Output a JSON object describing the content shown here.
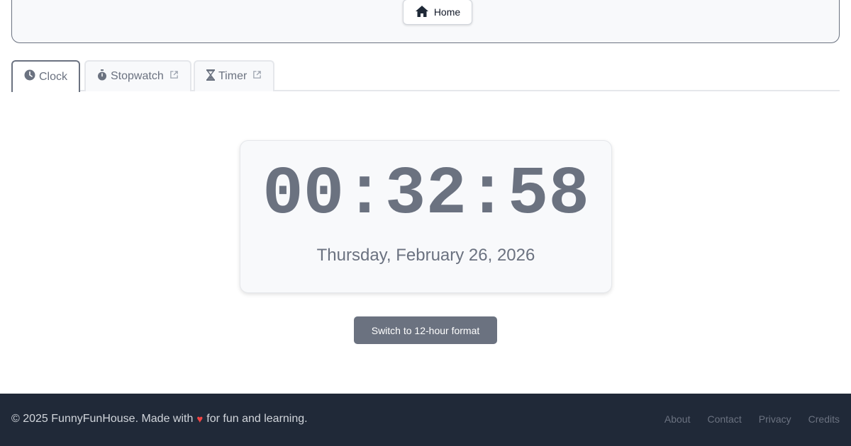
{
  "nav": {
    "home_label": "Home",
    "home_icon": "home-icon"
  },
  "tabs": [
    {
      "label": "Clock",
      "icon": "clock-icon",
      "active": true,
      "external": false
    },
    {
      "label": "Stopwatch",
      "icon": "stopwatch-icon",
      "active": false,
      "external": true
    },
    {
      "label": "Timer",
      "icon": "hourglass-icon",
      "active": false,
      "external": true
    }
  ],
  "clock": {
    "time": "00:32:58",
    "date": "Thursday, February 26, 2026"
  },
  "format_toggle": {
    "label": "Switch to 12-hour format"
  },
  "footer": {
    "copyright_prefix": "© 2025 FunnyFunHouse. Made with",
    "copyright_suffix": "for fun and learning.",
    "heart_glyph": "♥",
    "links": [
      "About",
      "Contact",
      "Privacy",
      "Credits"
    ]
  },
  "colors": {
    "accent_gray": "#6b7280",
    "footer_bg": "#202938",
    "heart": "#ef4444"
  }
}
